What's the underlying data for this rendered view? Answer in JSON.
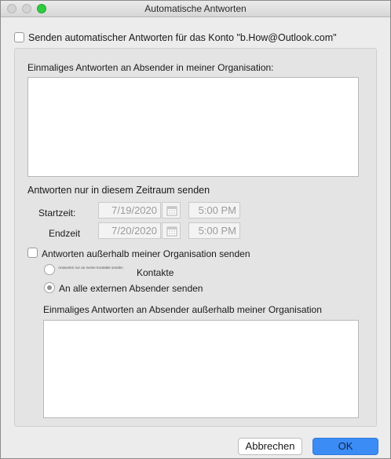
{
  "window": {
    "title": "Automatische Antworten"
  },
  "send_auto_replies": {
    "label": "Senden automatischer Antworten für das Konto \"b.How@Outlook.com\"",
    "checked": false
  },
  "internal": {
    "label": "Einmaliges Antworten an Absender in meiner Organisation:",
    "message": ""
  },
  "time_range": {
    "label": "Antworten nur in diesem Zeitraum senden",
    "start_label": "Startzeit:",
    "start_date": "7/19/2020",
    "start_time": "5:00 PM",
    "end_label": "Endzeit",
    "end_date": "7/20/2020",
    "end_time": "5:00 PM"
  },
  "external": {
    "checkbox_label": "Antworten außerhalb meiner Organisation senden",
    "checked": false,
    "option_contacts_small": "Antworten nur an meine Kontakte senden",
    "option_contacts": "Kontakte",
    "option_all": "An alle externen Absender senden",
    "selected_option": "all",
    "message_label": "Einmaliges Antworten an Absender außerhalb meiner Organisation",
    "message": ""
  },
  "buttons": {
    "cancel": "Abbrechen",
    "ok": "OK"
  },
  "colors": {
    "ok_button": "#3b8cf5",
    "zoom_button": "#2ecc40"
  }
}
